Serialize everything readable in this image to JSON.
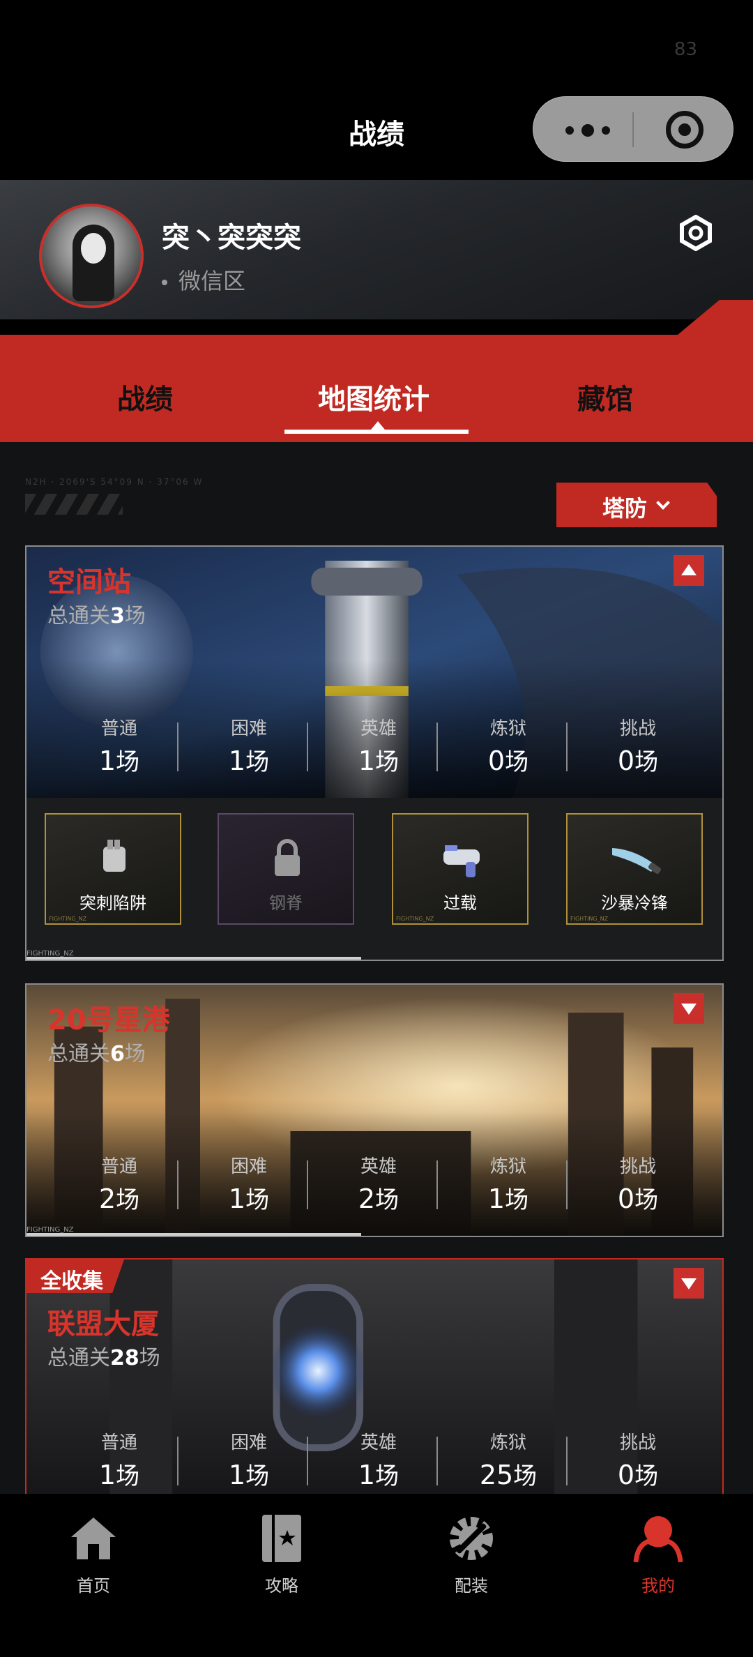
{
  "status": {
    "num": "83"
  },
  "header": {
    "title": "战绩"
  },
  "profile": {
    "username": "突丶突突突",
    "region": "微信区"
  },
  "tabs": [
    {
      "label": "战绩"
    },
    {
      "label": "地图统计",
      "active": true
    },
    {
      "label": "藏馆"
    }
  ],
  "filter": {
    "mode": "塔防"
  },
  "difficulty_labels": [
    "普通",
    "困难",
    "英雄",
    "炼狱",
    "挑战"
  ],
  "unit": "场",
  "maps": [
    {
      "name": "空间站",
      "total_prefix": "总通关",
      "total": "3",
      "total_unit": "场",
      "expanded": true,
      "counts": [
        "1",
        "1",
        "1",
        "0",
        "0"
      ],
      "weapons": [
        {
          "name": "突刺陷阱",
          "locked": false
        },
        {
          "name": "钢脊",
          "locked": true
        },
        {
          "name": "过载",
          "locked": false
        },
        {
          "name": "沙暴冷锋",
          "locked": false
        }
      ]
    },
    {
      "name": "20号星港",
      "total_prefix": "总通关",
      "total": "6",
      "total_unit": "场",
      "expanded": false,
      "counts": [
        "2",
        "1",
        "2",
        "1",
        "0"
      ]
    },
    {
      "name": "联盟大厦",
      "total_prefix": "总通关",
      "total": "28",
      "total_unit": "场",
      "expanded": false,
      "badge": "全收集",
      "counts": [
        "1",
        "1",
        "1",
        "25",
        "0"
      ]
    }
  ],
  "footer_tag": "FIGHTING_NZ",
  "bottom_nav": [
    {
      "label": "首页",
      "icon": "home-icon"
    },
    {
      "label": "攻略",
      "icon": "guide-book-icon"
    },
    {
      "label": "配装",
      "icon": "gear-wrench-icon"
    },
    {
      "label": "我的",
      "icon": "profile-icon",
      "active": true
    }
  ],
  "colors": {
    "accent_red": "#c12a22",
    "map_title_red": "#d9342b",
    "gold_border": "#b0903a"
  }
}
